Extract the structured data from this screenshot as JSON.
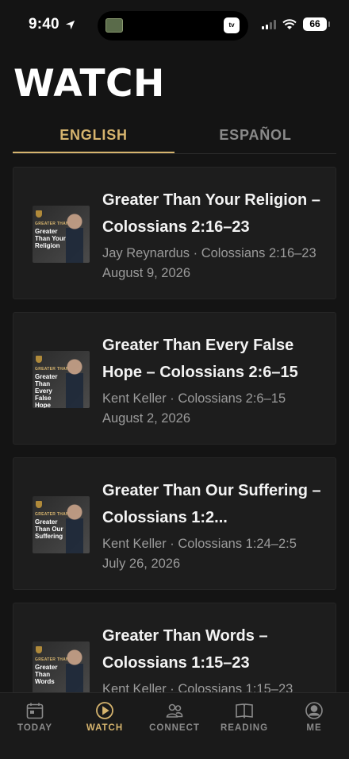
{
  "status": {
    "time": "9:40",
    "battery": "66",
    "island_badge": "tv"
  },
  "page": {
    "title": "WATCH"
  },
  "tabs": [
    {
      "label": "ENGLISH",
      "active": true
    },
    {
      "label": "ESPAÑOL",
      "active": false
    }
  ],
  "sermons": [
    {
      "title": "Greater Than Your Religion – Colossians 2:16–23",
      "speaker_ref": "Jay Reynardus · Colossians 2:16–23",
      "date": "August 9, 2026",
      "thumb_series": "GREATER THAN",
      "thumb_title": "Greater Than Your Religion"
    },
    {
      "title": "Greater Than Every False Hope – Colossians 2:6–15",
      "speaker_ref": "Kent Keller · Colossians 2:6–15",
      "date": "August 2, 2026",
      "thumb_series": "GREATER THAN",
      "thumb_title": "Greater Than Every False Hope"
    },
    {
      "title": "Greater Than Our Suffering – Colossians 1:2...",
      "speaker_ref": "Kent Keller · Colossians 1:24–2:5",
      "date": "July 26, 2026",
      "thumb_series": "GREATER THAN",
      "thumb_title": "Greater Than Our Suffering"
    },
    {
      "title": "Greater Than Words – Colossians 1:15–23",
      "speaker_ref": "Kent Keller · Colossians 1:15–23",
      "date": "",
      "thumb_series": "GREATER THAN",
      "thumb_title": "Greater Than Words"
    }
  ],
  "nav": [
    {
      "label": "TODAY",
      "icon": "calendar-icon",
      "active": false
    },
    {
      "label": "WATCH",
      "icon": "play-icon",
      "active": true
    },
    {
      "label": "CONNECT",
      "icon": "people-icon",
      "active": false
    },
    {
      "label": "READING",
      "icon": "book-icon",
      "active": false
    },
    {
      "label": "ME",
      "icon": "person-icon",
      "active": false
    }
  ],
  "colors": {
    "accent": "#d6b46e",
    "background": "#141414",
    "card": "#1d1d1d",
    "muted": "#9b9b9b"
  }
}
